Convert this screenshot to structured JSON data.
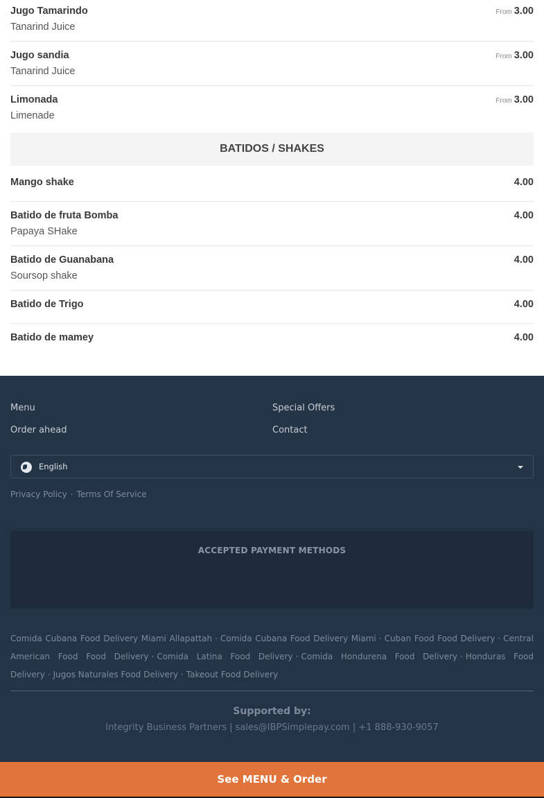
{
  "menu": {
    "juices": [
      {
        "name": "Jugo Tamarindo",
        "desc": "Tanarind Juice",
        "from": "From",
        "price": "3.00"
      },
      {
        "name": "Jugo sandia",
        "desc": "Tanarind Juice",
        "from": "From",
        "price": "3.00"
      },
      {
        "name": "Limonada",
        "desc": "Limenade",
        "from": "From",
        "price": "3.00"
      }
    ],
    "shakes_header": "BATIDOS / SHAKES",
    "shakes": [
      {
        "name": "Mango shake",
        "price": "4.00"
      },
      {
        "name": "Batido de fruta Bomba",
        "desc": "Papaya SHake",
        "price": "4.00"
      },
      {
        "name": "Batido de Guanabana",
        "desc": "Soursop shake",
        "price": "4.00"
      },
      {
        "name": "Batido de Trigo",
        "price": "4.00"
      },
      {
        "name": "Batido de mamey",
        "price": "4.00"
      }
    ]
  },
  "footer": {
    "links": [
      "Menu",
      "Special Offers",
      "Order ahead",
      "Contact"
    ],
    "language": {
      "icon": "globe-icon",
      "selected": "English"
    },
    "legal": [
      "Privacy Policy",
      "Terms Of Service"
    ],
    "payment_title": "ACCEPTED PAYMENT METHODS",
    "seo_links": [
      "Comida Cubana Food Delivery Miami Allapattah",
      "Comida Cubana Food Delivery Miami",
      "Cuban Food Food Delivery",
      "Central American Food Food Delivery",
      "Comida Latina Food Delivery",
      "Comida Hondurena Food Delivery",
      "Honduras Food Delivery",
      "Jugos Naturales Food Delivery",
      "Takeout Food Delivery"
    ],
    "supported_by": "Supported by:",
    "contact": "Integrity Business Partners | sales@IBPSimplepay.com | +1 888-930-9057"
  },
  "order_bar": {
    "label": "See MENU & Order"
  },
  "colors": {
    "footer_bg": "#243447",
    "order_bar": "#e0743b"
  }
}
